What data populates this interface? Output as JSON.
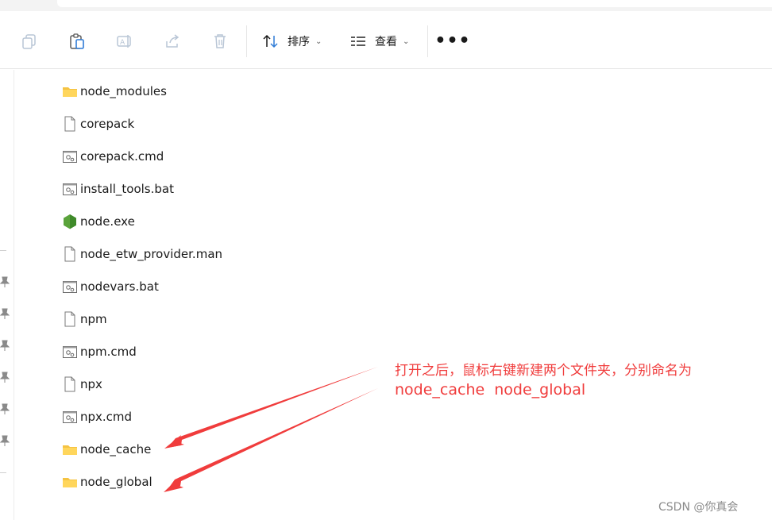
{
  "toolbar": {
    "sort_label": "排序",
    "view_label": "查看",
    "more_label": "•••",
    "chevron": "⌄"
  },
  "files": [
    {
      "name": "node_modules",
      "icon": "folder-icon"
    },
    {
      "name": "corepack",
      "icon": "file-icon"
    },
    {
      "name": "corepack.cmd",
      "icon": "script-file-icon"
    },
    {
      "name": "install_tools.bat",
      "icon": "script-file-icon"
    },
    {
      "name": "node.exe",
      "icon": "nodejs-icon"
    },
    {
      "name": "node_etw_provider.man",
      "icon": "file-icon"
    },
    {
      "name": "nodevars.bat",
      "icon": "script-file-icon"
    },
    {
      "name": "npm",
      "icon": "file-icon"
    },
    {
      "name": "npm.cmd",
      "icon": "script-file-icon"
    },
    {
      "name": "npx",
      "icon": "file-icon"
    },
    {
      "name": "npx.cmd",
      "icon": "script-file-icon"
    },
    {
      "name": "node_cache",
      "icon": "folder-icon"
    },
    {
      "name": "node_global",
      "icon": "folder-icon"
    }
  ],
  "annotation": {
    "line1": "打开之后，鼠标右键新建两个文件夹，分别命名为",
    "line2": "node_cache  node_global",
    "color": "#f03c3c"
  },
  "watermark": "CSDN @你真会"
}
